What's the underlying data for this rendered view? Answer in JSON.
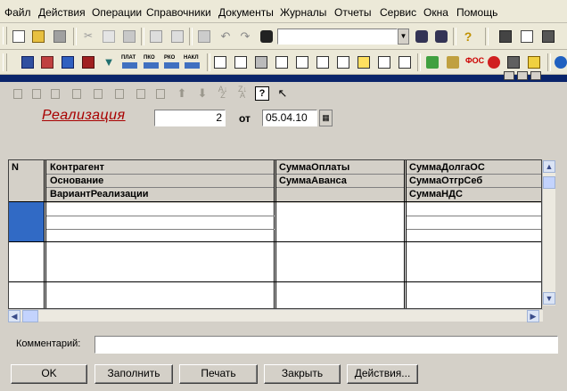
{
  "menu": {
    "items": [
      "Файл",
      "Действия",
      "Операции",
      "Справочники",
      "Документы",
      "Журналы",
      "Отчеты",
      "Сервис",
      "Окна",
      "Помощь"
    ]
  },
  "toolbar2": {
    "labels": [
      "ПЛАТ",
      "ПКО",
      "РКО",
      "НАКЛ"
    ]
  },
  "toolbar2b": {
    "labels": [
      "ФОС",
      "ИНТ"
    ]
  },
  "document": {
    "title": "Реализация",
    "number": "2",
    "from_label": "от",
    "date": "05.04.10"
  },
  "grid": {
    "col_n": "N",
    "col1": [
      "Контрагент",
      "Основание",
      "ВариантРеализации"
    ],
    "col2": [
      "СуммаОплаты",
      "СуммаАванса"
    ],
    "col3": [
      "СуммаДолгаОС",
      "СуммаОтгрСеб",
      "СуммаНДС"
    ]
  },
  "comment": {
    "label": "Комментарий:",
    "value": ""
  },
  "buttons": {
    "ok": "OK",
    "fill": "Заполнить",
    "print": "Печать",
    "close": "Закрыть",
    "actions": "Действия..."
  },
  "colors": {
    "selection": "#316ac5",
    "title_red": "#a80000",
    "window_title": "#0a246a"
  }
}
